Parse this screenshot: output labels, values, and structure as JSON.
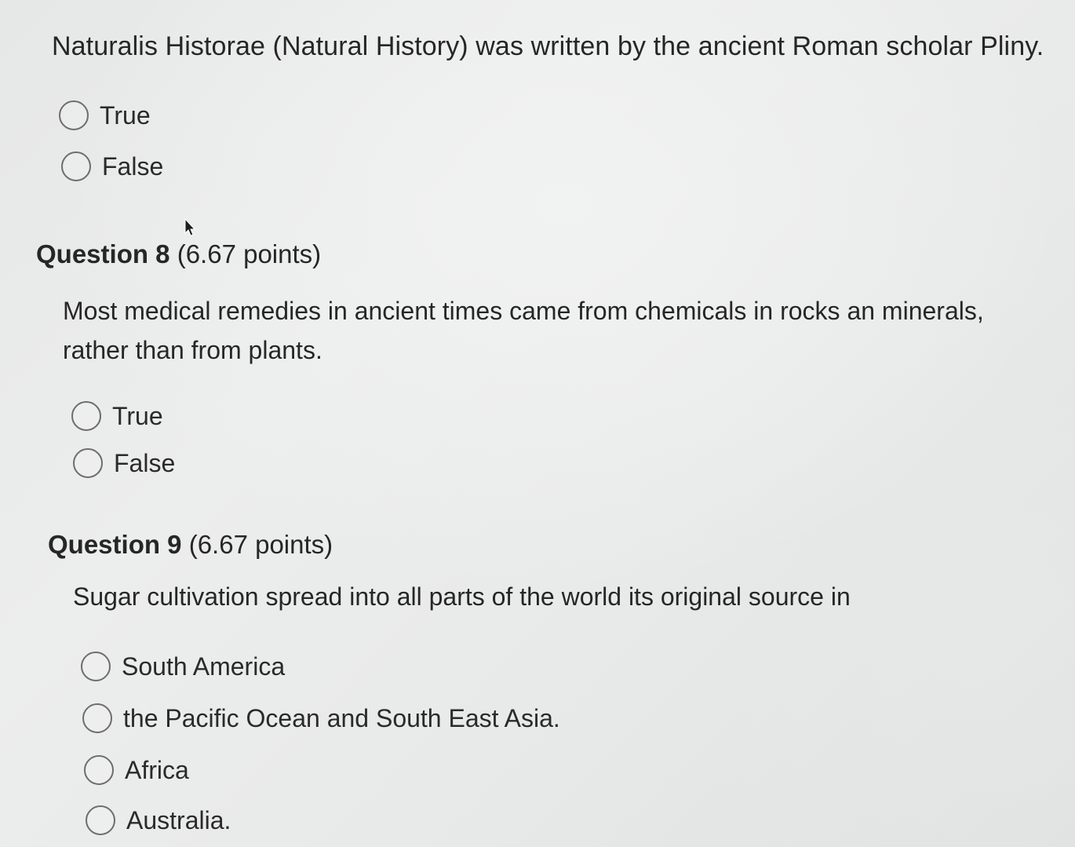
{
  "q7": {
    "text": "Naturalis Historae (Natural History) was written by the ancient Roman scholar Pliny.",
    "options": [
      "True",
      "False"
    ]
  },
  "q8": {
    "title": "Question 8",
    "points": "(6.67 points)",
    "text": "Most medical remedies in ancient times came from chemicals in rocks an minerals, rather than from plants.",
    "options": [
      "True",
      "False"
    ]
  },
  "q9": {
    "title": "Question 9",
    "points": "(6.67 points)",
    "text": "Sugar cultivation spread into all parts of the world its original source in",
    "options": [
      "South America",
      "the Pacific Ocean and South East Asia.",
      "Africa",
      "Australia."
    ]
  },
  "icons": {
    "cursor": "mouse-pointer-icon",
    "radio": "radio-button-icon"
  }
}
